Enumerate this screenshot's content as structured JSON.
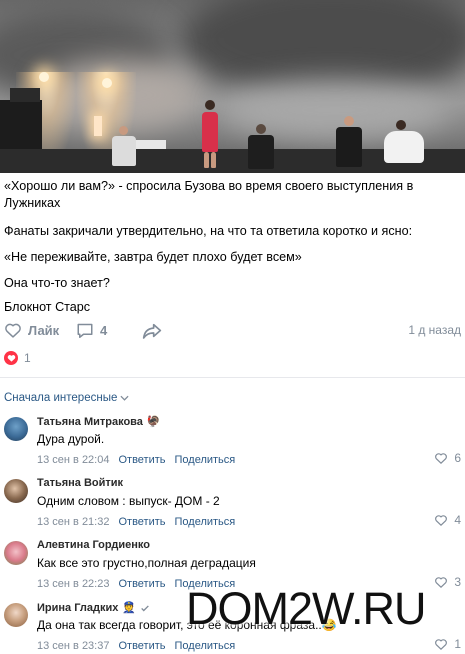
{
  "post": {
    "text": [
      "«Хорошо ли вам?» - спросила Бузова во время своего выступления в Лужниках",
      "Фанаты закричали утвердительно, на что та ответила коротко и ясно:",
      "«Не переживайте, завтра будет плохо будет всем»",
      "Она что-то знает?",
      "Блокнот Старс"
    ],
    "like_label": "Лайк",
    "comment_count": "4",
    "time_ago": "1 д назад",
    "reactions_count": "1"
  },
  "comments_header": {
    "sort_label": "Сначала интересные"
  },
  "comments": [
    {
      "author": "Татьяна Митракова",
      "badge": "🦃",
      "text": "Дура дурой.",
      "date": "13 сен в 22:04",
      "reply": "Ответить",
      "share": "Поделиться",
      "likes": "6"
    },
    {
      "author": "Татьяна Войтик",
      "badge": "",
      "text": "Одним словом : выпуск- ДОМ - 2",
      "date": "13 сен в 21:32",
      "reply": "Ответить",
      "share": "Поделиться",
      "likes": "4"
    },
    {
      "author": "Алевтина Гордиенко",
      "badge": "",
      "text": "Как все это грустно,полная деградация",
      "date": "13 сен в 22:23",
      "reply": "Ответить",
      "share": "Поделиться",
      "likes": "3"
    },
    {
      "author": "Ирина Гладких",
      "badge": "👮",
      "text": "Да она так всегда говорит, это её коронная фраза..😂",
      "date": "13 сен в 23:37",
      "reply": "Ответить",
      "share": "Поделиться",
      "likes": "1"
    }
  ],
  "watermark": "DOM2W.RU",
  "colors": {
    "link": "#2a5885",
    "muted": "#818c99",
    "heart": "#ff3347"
  },
  "icons": [
    "heart-icon",
    "comment-icon",
    "share-icon",
    "chevron-down-icon",
    "verified-icon"
  ]
}
